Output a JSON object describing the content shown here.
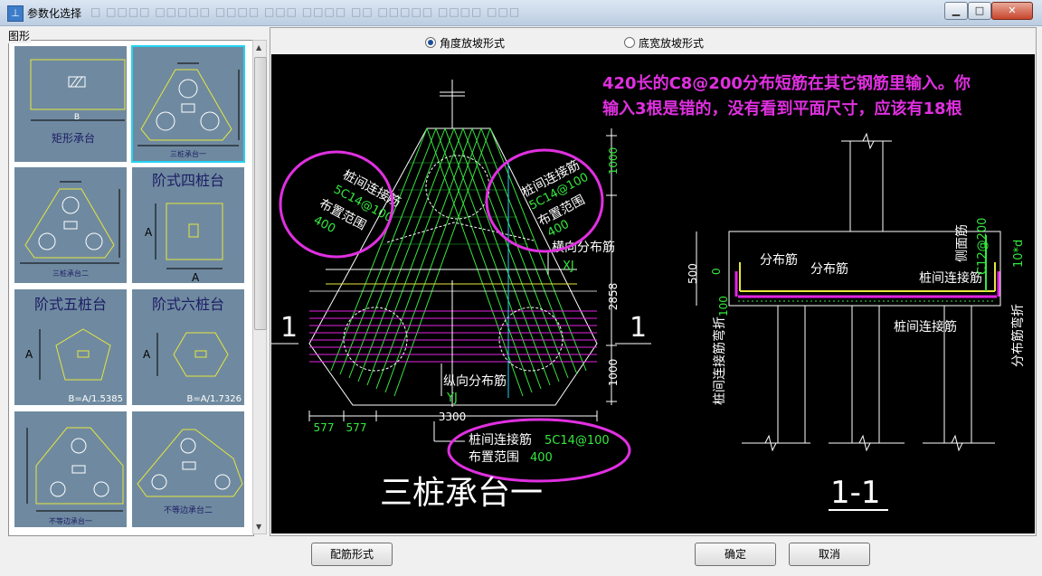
{
  "window": {
    "title": "参数化选择",
    "app_icon_glyph": "⊥",
    "menu_strip_blurred": "□  □□□□  □□□□□  □□□□  □□□  □□□□  □□  □□□□□  □□□□  □□□"
  },
  "left_panel": {
    "group_label": "图形",
    "thumbnails": [
      {
        "name": "矩形承台",
        "label": "矩形承台",
        "dim": "B",
        "selected": false
      },
      {
        "name": "三桩承台一",
        "label": "三桩承台一",
        "selected": true
      },
      {
        "name": "三桩承台二",
        "label": "三桩承台二",
        "selected": false
      },
      {
        "name": "阶式四桩台",
        "label": "阶式四桩台",
        "dim_a": "A",
        "dim_a2": "A",
        "selected": false
      },
      {
        "name": "阶式五桩台",
        "label": "阶式五桩台",
        "dim_a": "A",
        "formula": "B=A/1.5385",
        "selected": false
      },
      {
        "name": "阶式六桩台",
        "label": "阶式六桩台",
        "dim_a": "A",
        "formula": "B=A/1.7326",
        "selected": false
      },
      {
        "name": "不等边承台一",
        "label": "不等边承台一",
        "selected": false
      },
      {
        "name": "不等边承台二",
        "label": "不等边承台二",
        "selected": false
      }
    ]
  },
  "options": {
    "angle_slope": "角度放坡形式",
    "width_slope": "底宽放坡形式",
    "selected": "angle_slope"
  },
  "drawing": {
    "annotation_line1": "420长的C8@200分布短筋在其它钢筋里输入。你",
    "annotation_line2": "输入3根是错的，没有看到平面尺寸，应该有18根",
    "plan_title": "三桩承台一",
    "section_title": "1-1",
    "section_mark": "1",
    "tie_bar": "桩间连接筋",
    "tie_bar_spec": "5C14@100",
    "layout_range": "布置范围",
    "layout_range_val": "400",
    "transverse_bar": "横向分布筋",
    "transverse_bar_code": "XJ",
    "longitudinal_bar": "纵向分布筋",
    "longitudinal_bar_code": "YJ",
    "dist_bar": "分布筋",
    "side_bar": "侧面筋",
    "side_bar_spec": "C12@200",
    "tie_bend": "桩间连接筋弯折",
    "dist_bend": "分布筋弯折",
    "bend_val": "10*d",
    "dim_1000a": "1000",
    "dim_2858": "2858",
    "dim_1000b": "1000",
    "dim_577a": "577",
    "dim_577b": "577",
    "dim_3300": "3300",
    "dim_500": "500",
    "dim_0": "0",
    "dim_100": "100"
  },
  "buttons": {
    "rebar_form": "配筋形式",
    "ok": "确定",
    "cancel": "取消"
  },
  "colors": {
    "thumb_bg": "#6f8aa0",
    "thumb_line": "#e6e63c",
    "selected_border": "#22d3f2",
    "canvas_bg": "#000000",
    "green_rebar": "#35e83e",
    "magenta": "#e424e4",
    "annotation": "#e030e0"
  }
}
